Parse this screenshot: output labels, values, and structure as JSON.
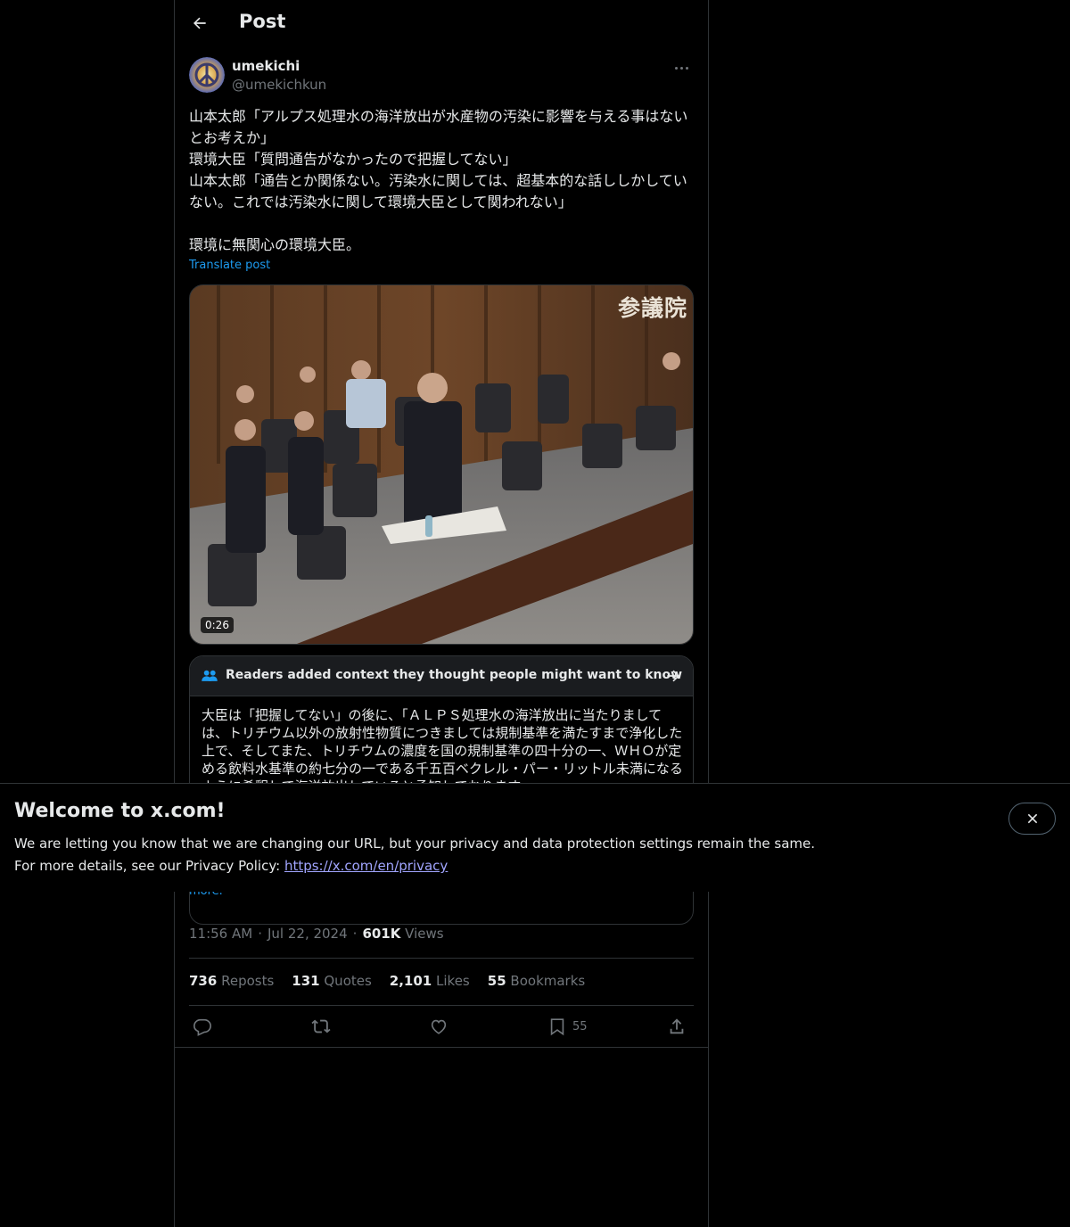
{
  "header": {
    "title": "Post"
  },
  "author": {
    "name": "umekichi",
    "handle": "@umekichkun"
  },
  "post": {
    "lines": [
      "山本太郎「アルプス処理水の海洋放出が水産物の汚染に影響を与える事はないとお考えか」",
      "環境大臣「質問通告がなかったので把握してない」",
      "山本太郎「通告とか関係ない。汚染水に関しては、超基本的な話ししかしていない。これでは汚染水に関して環境大臣として関われない」",
      "",
      "環境に無関心の環境大臣。"
    ],
    "translate_label": "Translate post"
  },
  "media": {
    "duration": "0:26",
    "watermark": "参議院"
  },
  "notes": {
    "title": "Readers added context they thought people might want to know",
    "body": "大臣は「把握してない」の後に、「ＡＬＰＳ処理水の海洋放出に当たりましては、トリチウム以外の放射性物質につきましては規制基準を満たすまで浄化した上で、そしてまた、トリチウムの濃度を国の規制基準の四十分の一、ＷＨＯが定める飲料水基準の約七分の一である千五百ベクレル・パー・リットル未満になるように希釈して海洋放出していると承知しております",
    "show_more": "more."
  },
  "meta": {
    "time": "11:56 AM",
    "date": "Jul 22, 2024",
    "views_count": "601K",
    "views_label": "Views"
  },
  "stats": {
    "reposts_count": "736",
    "reposts_label": "Reposts",
    "quotes_count": "131",
    "quotes_label": "Quotes",
    "likes_count": "2,101",
    "likes_label": "Likes",
    "bookmarks_count": "55",
    "bookmarks_label": "Bookmarks"
  },
  "actions": {
    "bookmark_count": "55"
  },
  "banner": {
    "title": "Welcome to x.com!",
    "line1": "We are letting you know that we are changing our URL, but your privacy and data protection settings remain the same.",
    "line2_prefix": "For more details, see our Privacy Policy: ",
    "link": "https://x.com/en/privacy"
  },
  "colors": {
    "background": "#000000",
    "text": "#e7e9ea",
    "muted": "#71767b",
    "accent": "#1d9bf0",
    "border": "#2f3336",
    "link": "#a1a5ff"
  },
  "icons": [
    "back-arrow-icon",
    "more-icon",
    "community-notes-icon",
    "arrow-right-icon",
    "reply-icon",
    "repost-icon",
    "like-icon",
    "bookmark-icon",
    "share-icon",
    "close-icon"
  ]
}
